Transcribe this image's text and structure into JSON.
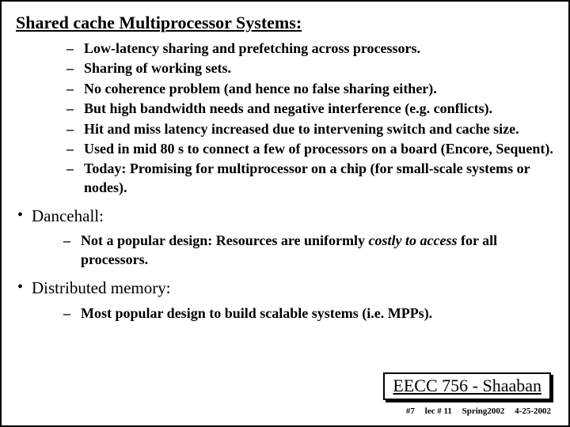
{
  "title": "Shared cache Multiprocessor Systems:",
  "shared_cache": {
    "items": [
      "Low-latency sharing and prefetching across processors.",
      "Sharing of working sets.",
      "No coherence problem (and hence no false sharing either).",
      "But high bandwidth needs and negative interference (e.g. conflicts).",
      "Hit and miss latency increased due to intervening switch and cache size.",
      "Used in mid 80 s to connect a few of processors on a board (Encore, Sequent).",
      "Today: Promising for multiprocessor on a chip (for small-scale systems or nodes)."
    ]
  },
  "dancehall": {
    "heading": "Dancehall:",
    "item_prefix": "Not a popular design:  Resources are uniformly ",
    "item_emph": "costly to access",
    "item_suffix": " for all processors."
  },
  "dist_mem": {
    "heading": "Distributed memory:",
    "item": "Most popular design to build scalable systems (i.e. MPPs)."
  },
  "footer": {
    "box": "EECC 756 - Shaaban",
    "slidenum": "#7",
    "lecnum": "lec # 11",
    "term": "Spring2002",
    "date": "4-25-2002"
  }
}
